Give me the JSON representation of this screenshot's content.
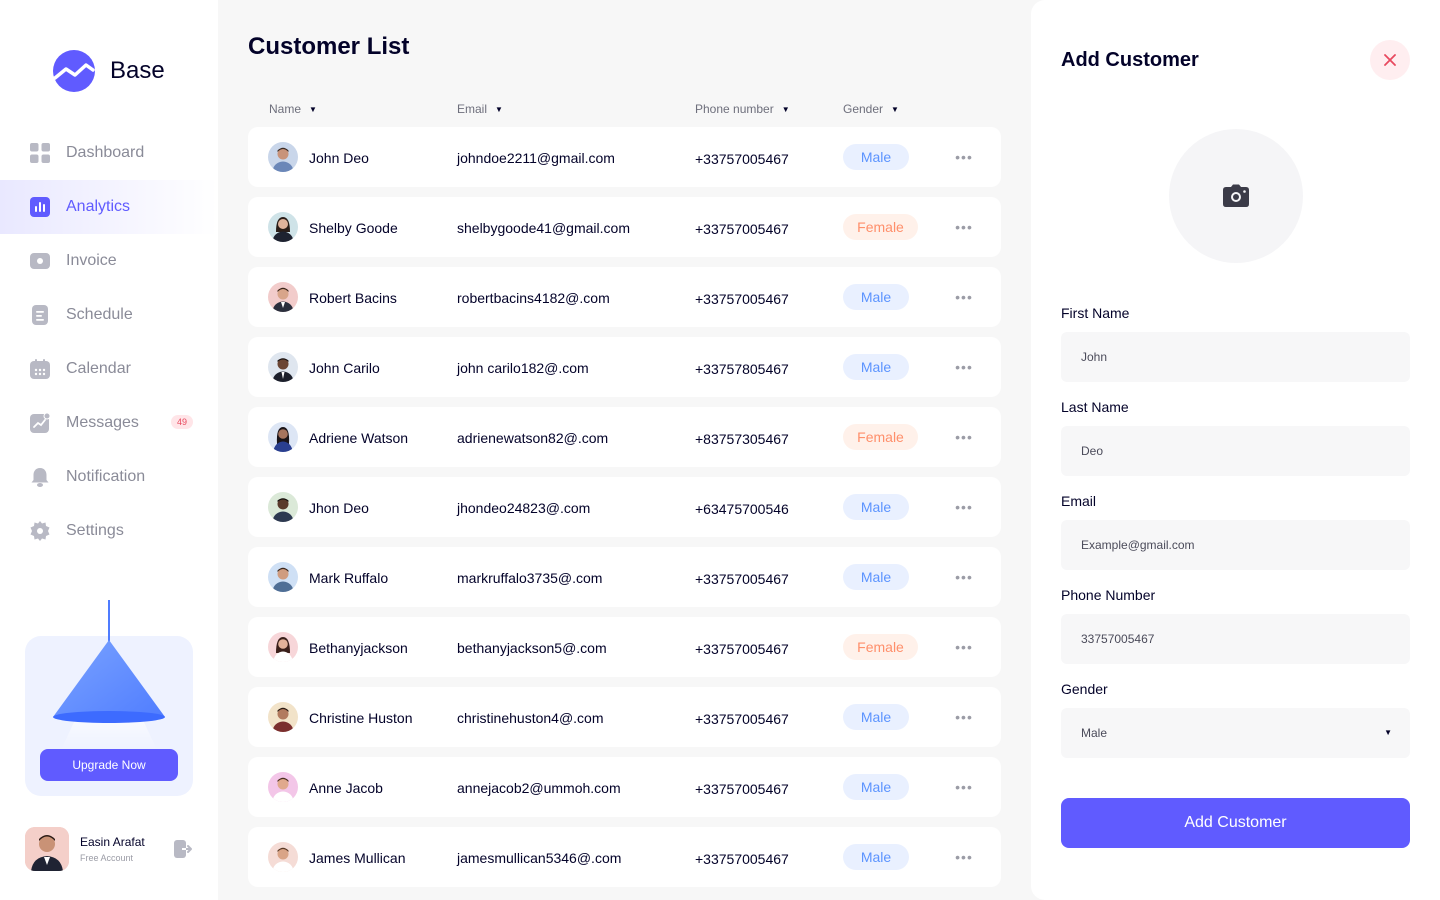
{
  "brand": {
    "name": "Base"
  },
  "sidebar": {
    "items": [
      {
        "label": "Dashboard",
        "icon": "dashboard-icon"
      },
      {
        "label": "Analytics",
        "icon": "analytics-icon",
        "active": true
      },
      {
        "label": "Invoice",
        "icon": "invoice-icon"
      },
      {
        "label": "Schedule",
        "icon": "schedule-icon"
      },
      {
        "label": "Calendar",
        "icon": "calendar-icon"
      },
      {
        "label": "Messages",
        "icon": "messages-icon",
        "badge": "49"
      },
      {
        "label": "Notification",
        "icon": "notification-icon"
      },
      {
        "label": "Settings",
        "icon": "settings-icon"
      }
    ],
    "upgrade_label": "Upgrade Now",
    "user": {
      "name": "Easin Arafat",
      "plan": "Free Account"
    }
  },
  "main": {
    "title": "Customer List",
    "columns": [
      "Name",
      "Email",
      "Phone number",
      "Gender"
    ],
    "rows": [
      {
        "name": "John Deo",
        "email": "johndoe2211@gmail.com",
        "phone": "+33757005467",
        "gender": "Male"
      },
      {
        "name": "Shelby Goode",
        "email": "shelbygoode41@gmail.com",
        "phone": "+33757005467",
        "gender": "Female"
      },
      {
        "name": "Robert Bacins",
        "email": "robertbacins4182@.com",
        "phone": "+33757005467",
        "gender": "Male"
      },
      {
        "name": "John Carilo",
        "email": "john carilo182@.com",
        "phone": "+33757805467",
        "gender": "Male"
      },
      {
        "name": "Adriene Watson",
        "email": "adrienewatson82@.com",
        "phone": "+83757305467",
        "gender": "Female"
      },
      {
        "name": "Jhon Deo",
        "email": "jhondeo24823@.com",
        "phone": "+63475700546",
        "gender": "Male"
      },
      {
        "name": "Mark Ruffalo",
        "email": "markruffalo3735@.com",
        "phone": "+33757005467",
        "gender": "Male"
      },
      {
        "name": "Bethanyjackson",
        "email": "bethanyjackson5@.com",
        "phone": "+33757005467",
        "gender": "Female"
      },
      {
        "name": "Christine Huston",
        "email": "christinehuston4@.com",
        "phone": "+33757005467",
        "gender": "Male"
      },
      {
        "name": "Anne Jacob",
        "email": "annejacob2@ummoh.com",
        "phone": "+33757005467",
        "gender": "Male"
      },
      {
        "name": "James Mullican",
        "email": "jamesmullican5346@.com",
        "phone": "+33757005467",
        "gender": "Male"
      }
    ]
  },
  "panel": {
    "title": "Add Customer",
    "fields": {
      "first_name": {
        "label": "First Name",
        "value": "John"
      },
      "last_name": {
        "label": "Last Name",
        "value": "Deo"
      },
      "email": {
        "label": "Email",
        "value": "Example@gmail.com"
      },
      "phone": {
        "label": "Phone Number",
        "value": "33757005467"
      },
      "gender": {
        "label": "Gender",
        "value": "Male"
      }
    },
    "submit_label": "Add Customer"
  },
  "colors": {
    "accent": "#605bff",
    "male_text": "#5b93ff",
    "male_bg": "#e9f0ff",
    "female_text": "#ff8f6b",
    "female_bg": "#fff1ea",
    "badge": "#e84a5f"
  }
}
